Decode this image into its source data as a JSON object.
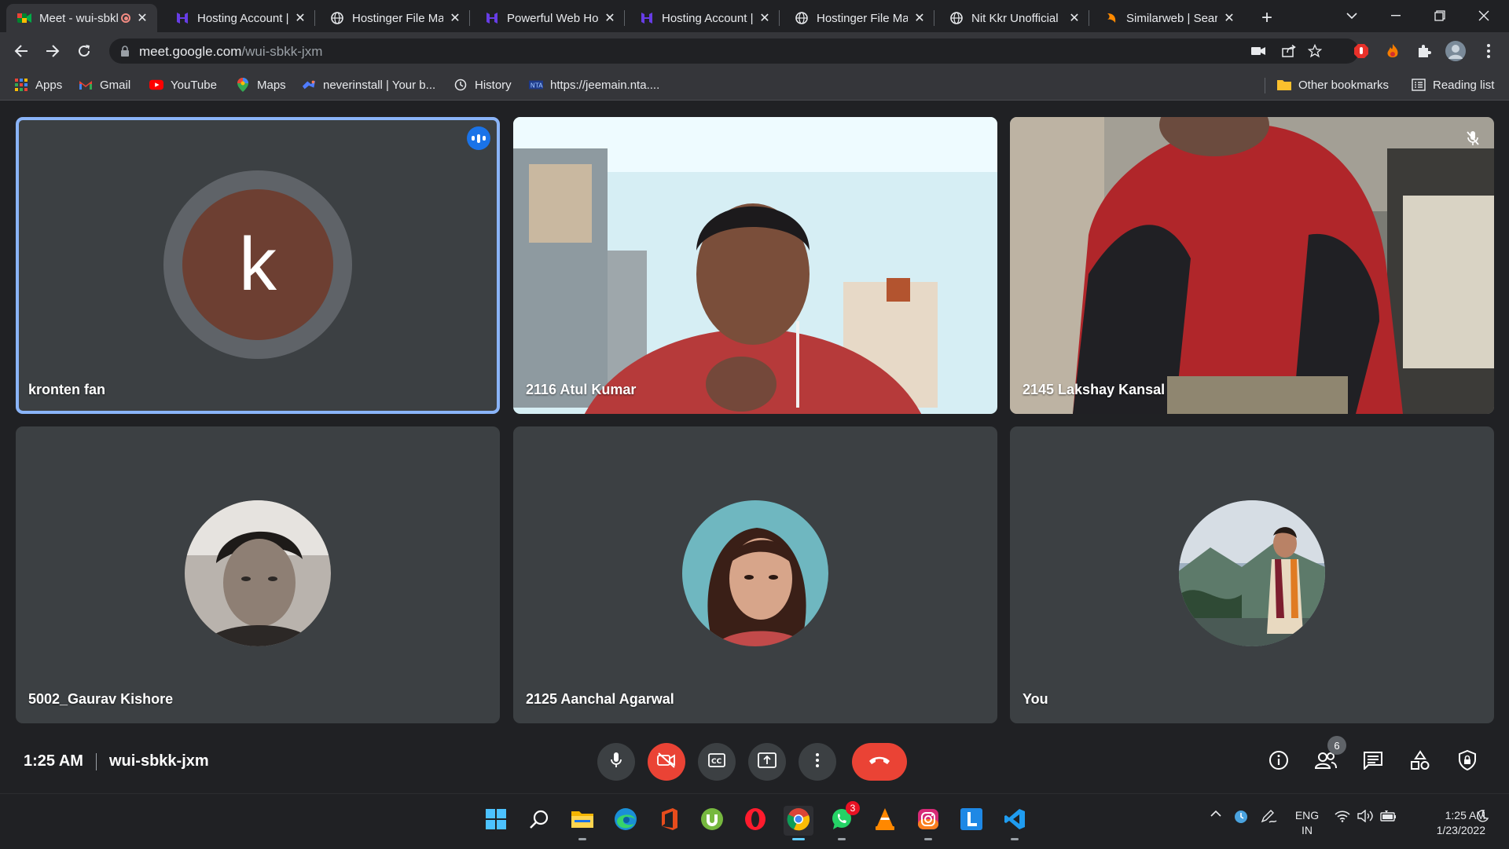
{
  "browser": {
    "tabs": [
      {
        "title": "Meet - wui-sbkk-jxm",
        "active": true,
        "recording": true
      },
      {
        "title": "Hosting Account | Hostinger"
      },
      {
        "title": "Hostinger File Manager"
      },
      {
        "title": "Powerful Web Hosting"
      },
      {
        "title": "Hosting Account | Hostinger"
      },
      {
        "title": "Hostinger File Manager"
      },
      {
        "title": "Nit Kkr Unofficial"
      },
      {
        "title": "Similarweb | Search"
      }
    ],
    "url_host": "meet.google.com",
    "url_path": "/wui-sbkk-jxm",
    "bookmarks": [
      {
        "label": "Apps"
      },
      {
        "label": "Gmail"
      },
      {
        "label": "YouTube"
      },
      {
        "label": "Maps"
      },
      {
        "label": "neverinstall | Your b..."
      },
      {
        "label": "History"
      },
      {
        "label": "https://jeemain.nta...."
      }
    ],
    "other_bookmarks": "Other bookmarks",
    "reading_list": "Reading list"
  },
  "meet": {
    "participants": [
      {
        "name": "kronten fan",
        "initial": "k",
        "speaking": true
      },
      {
        "name": "2116 Atul Kumar"
      },
      {
        "name": "2145 Lakshay Kansal",
        "muted": true
      },
      {
        "name": "5002_Gaurav Kishore"
      },
      {
        "name": "2125 Aanchal Agarwal"
      },
      {
        "name": "You"
      }
    ],
    "time": "1:25 AM",
    "meeting_code": "wui-sbkk-jxm",
    "people_count": "6"
  },
  "taskbar": {
    "whatsapp_badge": "3",
    "language": "ENG",
    "region": "IN",
    "time": "1:25 AM",
    "date": "1/23/2022"
  },
  "colors": {
    "accent": "#8ab4f8",
    "end_call": "#ea4335",
    "avatar_k": "#6d3f32"
  }
}
